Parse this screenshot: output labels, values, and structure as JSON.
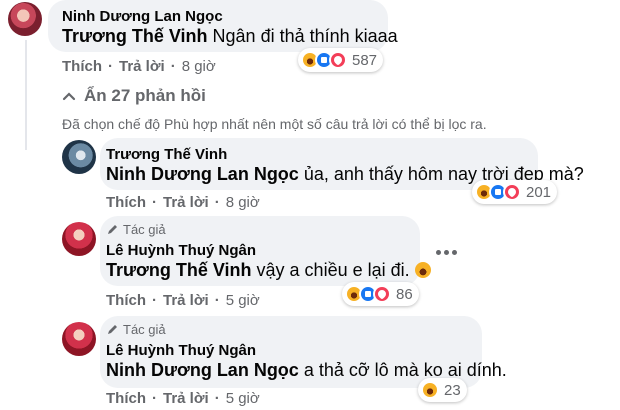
{
  "comments": [
    {
      "author": "Ninh Dương Lan Ngọc",
      "tagged": "Trương Thế Vinh",
      "text": "Ngân đi thả thính kiaaa",
      "like_label": "Thích",
      "reply_label": "Trả lời",
      "time": "8 giờ",
      "reactions": [
        "haha",
        "like",
        "love"
      ],
      "reaction_count": "587"
    }
  ],
  "replies_toggle": {
    "label": "Ẩn 27 phản hồi",
    "icon": "chevron-up-icon"
  },
  "filter_notice": "Đã chọn chế độ Phù hợp nhất nên một số câu trả lời có thể bị lọc ra.",
  "replies": [
    {
      "author": "Trương Thế Vinh",
      "tagged": "Ninh Dương Lan Ngọc",
      "text": "ủa, anh thấy hôm nay trời đẹp mà?",
      "like_label": "Thích",
      "reply_label": "Trả lời",
      "time": "8 giờ",
      "reaction_count": "201"
    },
    {
      "badge": "Tác giả",
      "author": "Lê Huỳnh Thuý Ngân",
      "tagged": "Trương Thế Vinh",
      "text": "vậy a chiều e lại đi.",
      "like_label": "Thích",
      "reply_label": "Trả lời",
      "time": "5 giờ",
      "reaction_count": "86"
    },
    {
      "badge": "Tác giả",
      "author": "Lê Huỳnh Thuý Ngân",
      "tagged": "Ninh Dương Lan Ngọc",
      "text": "a thả cỡ lô mà ko ai dính.",
      "like_label": "Thích",
      "reply_label": "Trả lời",
      "time": "5 giờ",
      "reaction_count": "23"
    }
  ],
  "colors": {
    "bubble": "#f0f2f5",
    "secondary_text": "#65676b",
    "like_blue": "#1877f2",
    "love_red": "#f33e58",
    "haha_yellow": "#f7b125"
  }
}
